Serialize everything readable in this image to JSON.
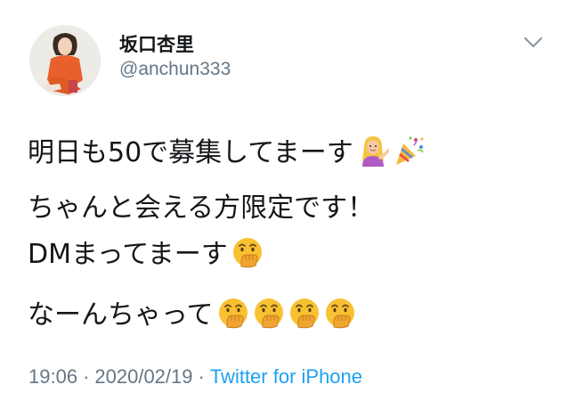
{
  "tweet": {
    "display_name": "坂口杏里",
    "handle": "@anchun333",
    "lines": [
      "明日も50で募集してまーす",
      "ちゃんと会える方限定です！",
      "DMまってまーす",
      "なーんちゃって"
    ],
    "emojis": {
      "line1": [
        "woman-tipping-hand-emoji",
        "party-popper-emoji"
      ],
      "line3": [
        "face-with-hand-over-mouth-emoji"
      ],
      "line4": [
        "face-with-hand-over-mouth-emoji",
        "face-with-hand-over-mouth-emoji",
        "face-with-hand-over-mouth-emoji",
        "face-with-hand-over-mouth-emoji"
      ]
    },
    "time": "19:06",
    "separator": "·",
    "date": "2020/02/19",
    "source": "Twitter for iPhone"
  },
  "icons": {
    "menu": "chevron-down-icon"
  },
  "colors": {
    "text": "#14171a",
    "secondary": "#657786",
    "link": "#1da1f2",
    "emoji_face": "#f7c132"
  }
}
